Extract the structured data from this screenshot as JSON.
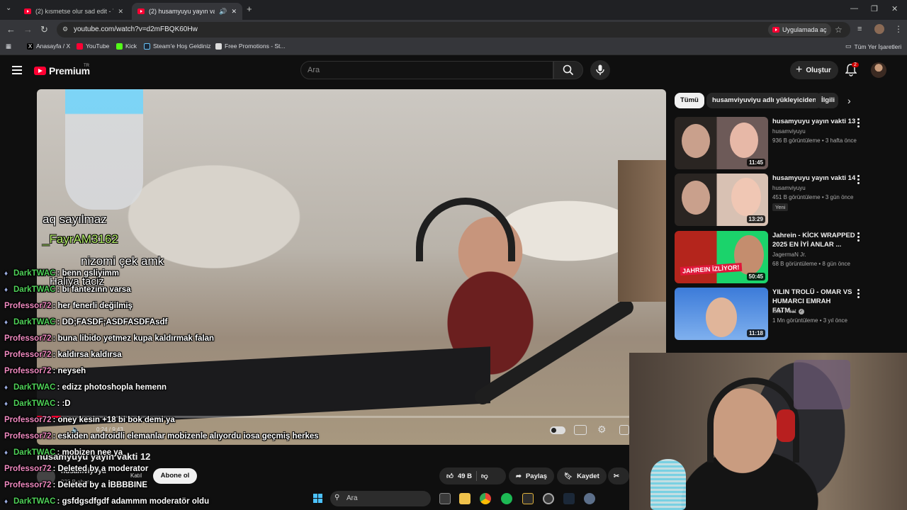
{
  "browser": {
    "tabs": [
      {
        "title": "(2) kısmetse olur sad edit - You",
        "active": false
      },
      {
        "title": "(2) husamyuyu yayın vakti 1",
        "active": true
      }
    ],
    "new_tab_label": "+",
    "url": "youtube.com/watch?v=d2mFBQK60Hw",
    "open_in_app_label": "Uygulamada aç",
    "bookmarks": [
      "Anasayfa / X",
      "YouTube",
      "Kick",
      "Steam'e Hoş Geldiniz",
      "Free Promotions - St..."
    ],
    "all_bookmarks_label": "Tüm Yer İşaretleri"
  },
  "youtube": {
    "logo_text": "Premium",
    "country_code": "TR",
    "search_placeholder": "Ara",
    "create_label": "Oluştur",
    "notification_count": "2"
  },
  "video": {
    "title": "husamyuyu yayın vakti 12",
    "current_time": "0:24 / 9:43",
    "progress": 0.041,
    "channel_name": "husamviyuyu",
    "subscribers": "323 B abone",
    "join_label": "Katıl",
    "subscribe_label": "Abone ol",
    "likes": "49 B",
    "share_label": "Paylaş",
    "save_label": "Kaydet"
  },
  "sidebar": {
    "chips": [
      "Tümü",
      "husamviyuviyu adlı yükleyiciden",
      "İlgili"
    ],
    "recommendations": [
      {
        "title": "husamyuyu yayın vakti 13",
        "channel": "husamviyuyu",
        "meta": "936 B görüntüleme • 3 hafta önce",
        "duration": "11:45",
        "badge": "",
        "verified": false
      },
      {
        "title": "husamyuyu yayın vakti 14",
        "channel": "husamviyuyu",
        "meta": "451 B görüntüleme • 3 gün önce",
        "duration": "13:29",
        "badge": "Yeni",
        "verified": false
      },
      {
        "title": "Jahrein - KİCK WRAPPED 2025 EN İYİ ANLAR ...",
        "channel": "JagermaN Jr.",
        "meta": "68 B görüntüleme • 8 gün önce",
        "duration": "50:45",
        "badge": "",
        "verified": false,
        "thumb_text": "JAHREIN İZLİYOR!"
      },
      {
        "title": "YILIN TROLÜ - OMAR VS HUMARCI EMRAH FATM...",
        "channel": "İlker Fırat",
        "meta": "1 Mn görüntüleme • 3 yıl önce",
        "duration": "11:18",
        "badge": "",
        "verified": true
      }
    ]
  },
  "overlay_captions": [
    {
      "text": "aq sayılmaz"
    },
    {
      "text": "_FayrAM3162"
    },
    {
      "text": "nizomi çek amk"
    },
    {
      "text": "Haliya taciz"
    }
  ],
  "chat": [
    {
      "user": "DarkTWAC",
      "msg": ": benn gsliyimm",
      "color": "#4fd158"
    },
    {
      "user": "DarkTWAC",
      "msg": ": bi fantezinn varsa",
      "color": "#4fd158"
    },
    {
      "user": "Professor72",
      "msg": ": her fenerli değilmiş",
      "color": "#f08ac0"
    },
    {
      "user": "DarkTWAC",
      "msg": ": DD;FASDF;ASDFASDFAsdf",
      "color": "#4fd158"
    },
    {
      "user": "Professor72",
      "msg": ": buna libido yetmez kupa kaldırmak falan",
      "color": "#f08ac0"
    },
    {
      "user": "Professor72",
      "msg": ": kaldırsa kaldırsa",
      "color": "#f08ac0"
    },
    {
      "user": "Professor72",
      "msg": ": neyseh",
      "color": "#f08ac0"
    },
    {
      "user": "DarkTWAC",
      "msg": ": edizz photoshopla hemenn",
      "color": "#4fd158"
    },
    {
      "user": "DarkTWAC",
      "msg": ": :D",
      "color": "#4fd158"
    },
    {
      "user": "Professor72",
      "msg": ": oney kesin +18 bi bok demi ya",
      "color": "#f08ac0"
    },
    {
      "user": "Professor72",
      "msg": ": eskiden androidli elemanlar mobizenle alıyordu iosa geçmiş herkes",
      "color": "#f08ac0"
    },
    {
      "user": "DarkTWAC",
      "msg": ": mobizen nee ya",
      "color": "#4fd158"
    },
    {
      "user": "Professor72",
      "msg": ": Deleted by a moderator",
      "color": "#f08ac0"
    },
    {
      "user": "Professor72",
      "msg": ": Deleted by a İBBBBINE",
      "color": "#f08ac0"
    },
    {
      "user": "DarkTWAC",
      "msg": ": gsfdgsdfgdf adammm moderatör oldu",
      "color": "#4fd158"
    }
  ],
  "taskbar": {
    "search_label": "Ara"
  },
  "colors": {
    "youtube_red": "#ff0033",
    "background": "#0f0f0f",
    "chip_bg": "#272727"
  }
}
